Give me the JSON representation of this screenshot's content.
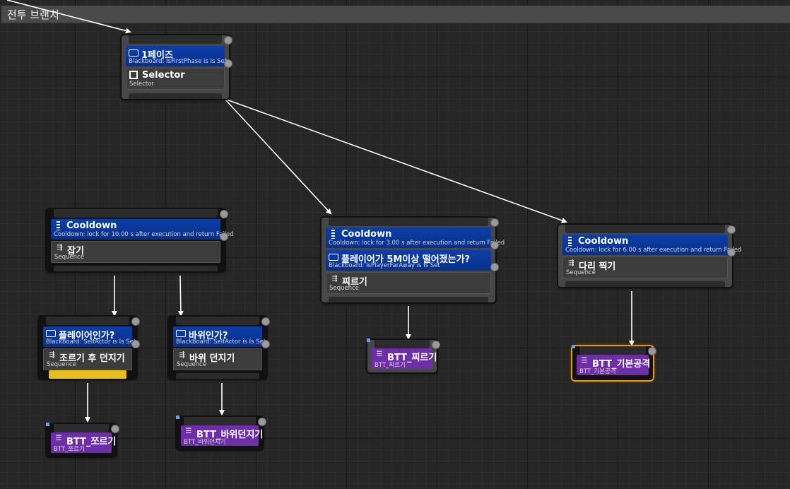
{
  "graph": {
    "comment_title": "전투 브랜치",
    "nodes": {
      "phase1": {
        "index": "0",
        "decorator_title": "1페이즈",
        "decorator_sub": "Blackboard: IsFirstPhase is Is Set",
        "decorator_index": "1",
        "composite_title": "Selector",
        "composite_sub": "Selector"
      },
      "grab": {
        "index": "1",
        "decorator_title": "Cooldown",
        "decorator_sub": "Cooldown: lock for 10.00 s after execution and return Failed",
        "decorator_index": "2",
        "composite_title": "잡기",
        "composite_sub": "Sequence"
      },
      "is_player": {
        "index": "3",
        "decorator_title": "플레이어인가?",
        "decorator_sub": "Blackboard: SelfActor is Is Set",
        "decorator_index": "4",
        "composite_title": "조르기 후 던지기",
        "composite_sub": "Sequence",
        "progress": 1.0
      },
      "is_rock": {
        "index": "5",
        "decorator_title": "바위인가?",
        "decorator_sub": "Blackboard: SelfActor is Is Set",
        "decorator_index": "6",
        "composite_title": "바위 던지기",
        "composite_sub": "Sequence"
      },
      "stab": {
        "index": "11",
        "decorator1_title": "Cooldown",
        "decorator1_sub": "Cooldown: lock for 3.00 s after execution and return Failed",
        "decorator1_index": "12",
        "decorator2_title": "플레이어가 5M이상 떨어졌는가?",
        "decorator2_sub": "Blackboard: IsPlayerFarAway is Is Set",
        "decorator2_index": "13",
        "composite_title": "찌르기",
        "composite_sub": "Sequence"
      },
      "leg_stomp": {
        "index": "15",
        "decorator_title": "Cooldown",
        "decorator_sub": "Cooldown: lock for 6.00 s after execution and return Failed",
        "decorator_index": "16",
        "composite_title": "다리 찍기",
        "composite_sub": "Sequence"
      },
      "task_squeeze": {
        "index": "4",
        "title": "BTT_쪼르기",
        "sub": "BTT_쪼르기"
      },
      "task_rockthrow": {
        "index": "5",
        "title": "BTT_바위던지기",
        "sub": "BTT_바위던지기"
      },
      "task_stab": {
        "index": "14",
        "title": "BTT_찌르기",
        "sub": "BTT_찌르기"
      },
      "task_basic": {
        "index": "17",
        "title": "BTT_기본공격",
        "sub": "BTT_기본공격"
      }
    }
  },
  "icons": {
    "blackboard": "blackboard-monitor-icon",
    "cooldown": "cooldown-icon",
    "sequence": "sequence-arrows-icon",
    "selector": "selector-icon",
    "task": "task-icon"
  },
  "colors": {
    "decorator": "#0b3fa8",
    "task": "#6e2ea8",
    "highlight": "#e89b17",
    "progress": "#e6c019"
  }
}
